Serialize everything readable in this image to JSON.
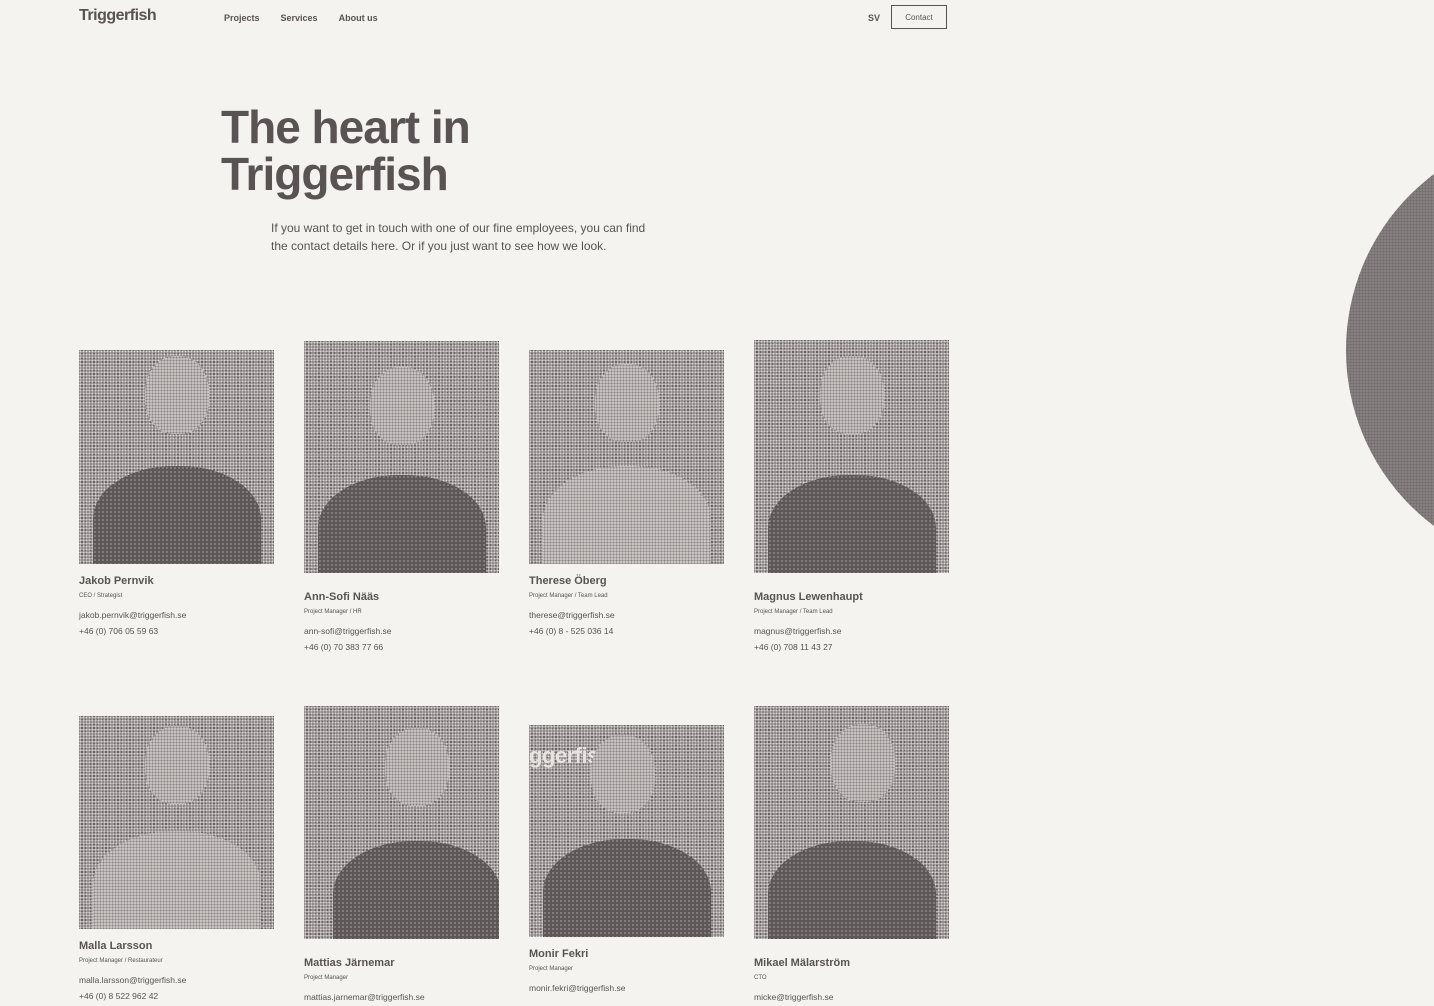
{
  "header": {
    "logo": "Triggerfish",
    "nav": [
      "Projects",
      "Services",
      "About us"
    ],
    "lang": "SV",
    "contact": "Contact"
  },
  "hero": {
    "title_line1": "The heart in",
    "title_line2": "Triggerfish",
    "intro": "If you want to get in touch with one of our fine employees, you can find the contact details here. Or if you just want to see how we look."
  },
  "team": [
    {
      "name": "Jakob Pernvik",
      "role": "CEO / Strategist",
      "email": "jakob.pernvik@triggerfish.se",
      "phone": "+46 (0) 706 05 59 63"
    },
    {
      "name": "Ann-Sofi Nääs",
      "role": "Project Manager / HR",
      "email": "ann-sofi@triggerfish.se",
      "phone": "+46 (0) 70 383 77 66"
    },
    {
      "name": "Therese Öberg",
      "role": "Project Manager / Team Lead",
      "email": "therese@triggerfish.se",
      "phone": "+46 (0) 8 - 525 036 14"
    },
    {
      "name": "Magnus Lewenhaupt",
      "role": "Project Manager / Team Lead",
      "email": "magnus@triggerfish.se",
      "phone": "+46 (0) 708 11 43 27"
    },
    {
      "name": "Malla Larsson",
      "role": "Project Manager / Restaurateur",
      "email": "malla.larsson@triggerfish.se",
      "phone": "+46 (0) 8 522 962 42"
    },
    {
      "name": "Mattias Järnemar",
      "role": "Project Manager",
      "email": "mattias.jarnemar@triggerfish.se",
      "phone": ""
    },
    {
      "name": "Monir Fekri",
      "role": "Project Manager",
      "email": "monir.fekri@triggerfish.se",
      "phone": ""
    },
    {
      "name": "Mikael Mälarström",
      "role": "CTO",
      "email": "micke@triggerfish.se",
      "phone": ""
    }
  ],
  "photo_overlay_text": "ggerfish"
}
